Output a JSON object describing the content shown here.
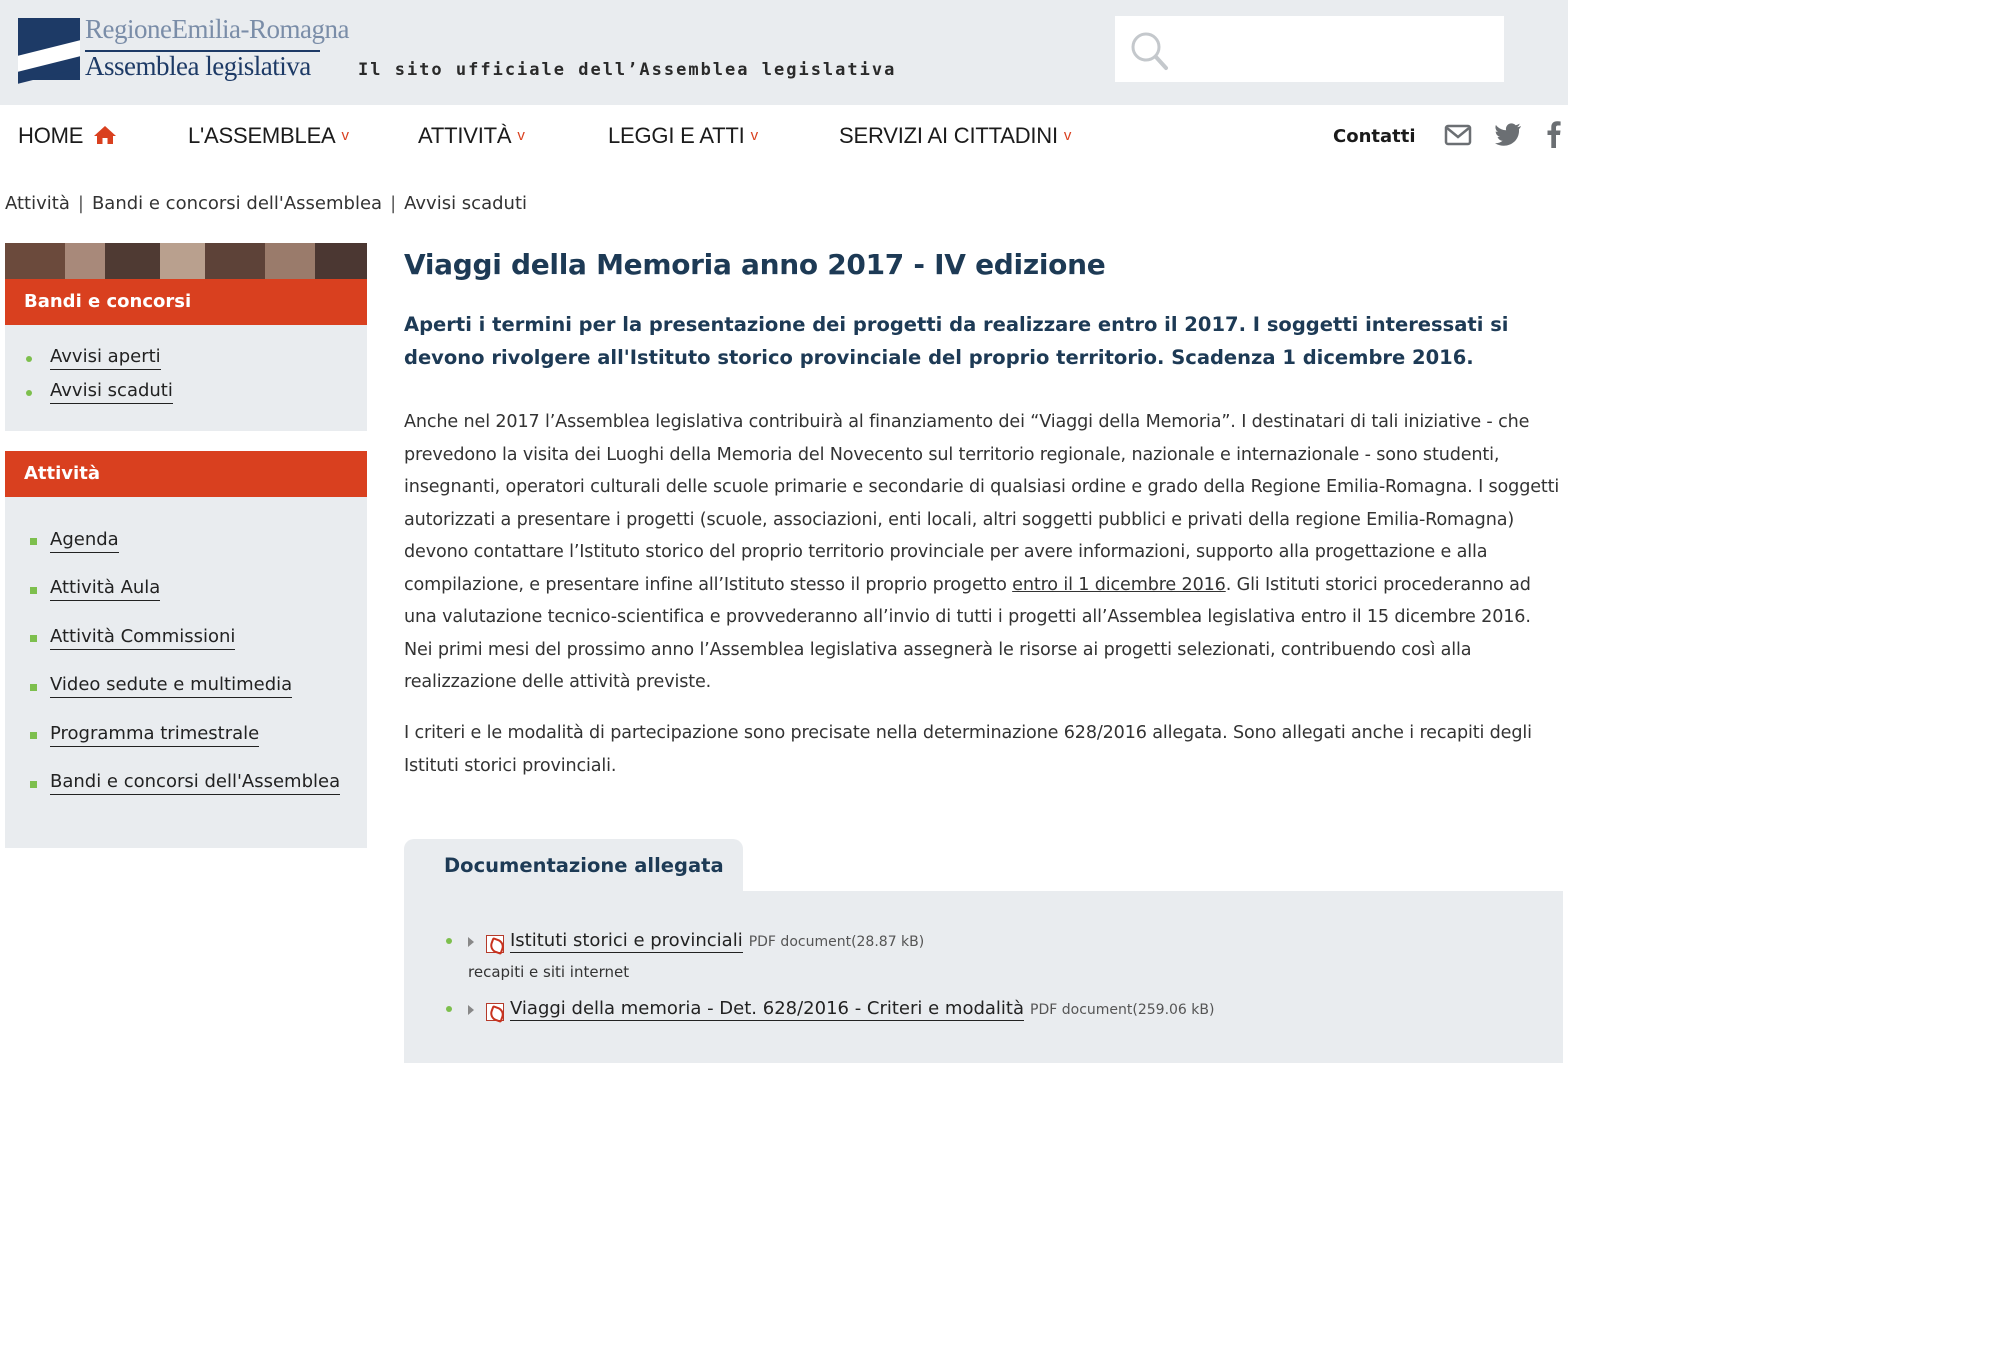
{
  "header": {
    "logo_line1": "RegioneEmilia-Romagna",
    "logo_line2": "Assemblea legislativa",
    "tagline": "Il sito ufficiale dell’Assemblea legislativa",
    "search_placeholder": ""
  },
  "nav": {
    "home": "HOME",
    "items": [
      {
        "label": "L'ASSEMBLEA"
      },
      {
        "label": "ATTIVITÀ"
      },
      {
        "label": "LEGGI E ATTI"
      },
      {
        "label": "SERVIZI AI CITTADINI"
      }
    ],
    "chevron": "v",
    "contatti": "Contatti",
    "icons": [
      "mail-icon",
      "twitter-icon",
      "facebook-icon"
    ]
  },
  "breadcrumb": [
    "Attività",
    "Bandi e concorsi dell'Assemblea",
    "Avvisi scaduti"
  ],
  "sidebar": {
    "bandi": {
      "title": "Bandi e concorsi",
      "items": [
        "Avvisi aperti",
        "Avvisi scaduti"
      ]
    },
    "attivita": {
      "title": "Attività",
      "items": [
        "Agenda",
        "Attività Aula",
        "Attività Commissioni",
        "Video sedute e multimedia",
        "Programma trimestrale",
        "Bandi e concorsi dell'Assemblea"
      ]
    }
  },
  "article": {
    "title": "Viaggi della Memoria anno 2017 - IV edizione",
    "lead": "Aperti i termini per la presentazione dei progetti da realizzare entro il 2017. I soggetti interessati si devono rivolgere all'Istituto storico provinciale del proprio territorio. Scadenza 1 dicembre 2016.",
    "p1_before": "Anche nel 2017 l’Assemblea legislativa contribuirà al finanziamento dei “Viaggi della Memoria”. I destinatari di tali iniziative - che prevedono la visita dei Luoghi della Memoria del Novecento sul territorio regionale, nazionale e internazionale - sono studenti, insegnanti, operatori culturali delle scuole primarie e secondarie di qualsiasi ordine e grado della Regione Emilia-Romagna. I soggetti autorizzati a presentare i progetti (scuole, associazioni, enti locali, altri soggetti pubblici e privati della regione Emilia-Romagna) devono contattare l’Istituto storico del proprio territorio provinciale per avere informazioni, supporto alla progettazione e alla compilazione, e presentare infine all’Istituto stesso il proprio progetto ",
    "p1_link": "entro il 1 dicembre 2016",
    "p1_after": ". Gli Istituti storici procederanno ad una valutazione tecnico-scientifica e provvederanno all’invio di tutti i progetti all’Assemblea legislativa entro il 15 dicembre 2016. Nei primi mesi del prossimo anno l’Assemblea legislativa assegnerà le risorse ai progetti selezionati, contribuendo così alla realizzazione delle attività previste.",
    "p2": "I criteri e le modalità di partecipazione sono precisate nella determinazione 628/2016 allegata.  Sono allegati anche i recapiti degli Istituti storici provinciali."
  },
  "attachments": {
    "tab_label": "Documentazione allegata",
    "items": [
      {
        "title": "Istituti storici e provinciali",
        "meta": "PDF document(28.87 kB)",
        "description": "recapiti e siti internet"
      },
      {
        "title": "Viaggi della memoria - Det. 628/2016 - Criteri e modalità",
        "meta": "PDF document(259.06 kB)",
        "description": ""
      }
    ]
  },
  "colors": {
    "accent": "#d9401f",
    "bullet": "#7dbf4d",
    "title": "#1d3a55",
    "panel_bg": "#e9ecef"
  }
}
